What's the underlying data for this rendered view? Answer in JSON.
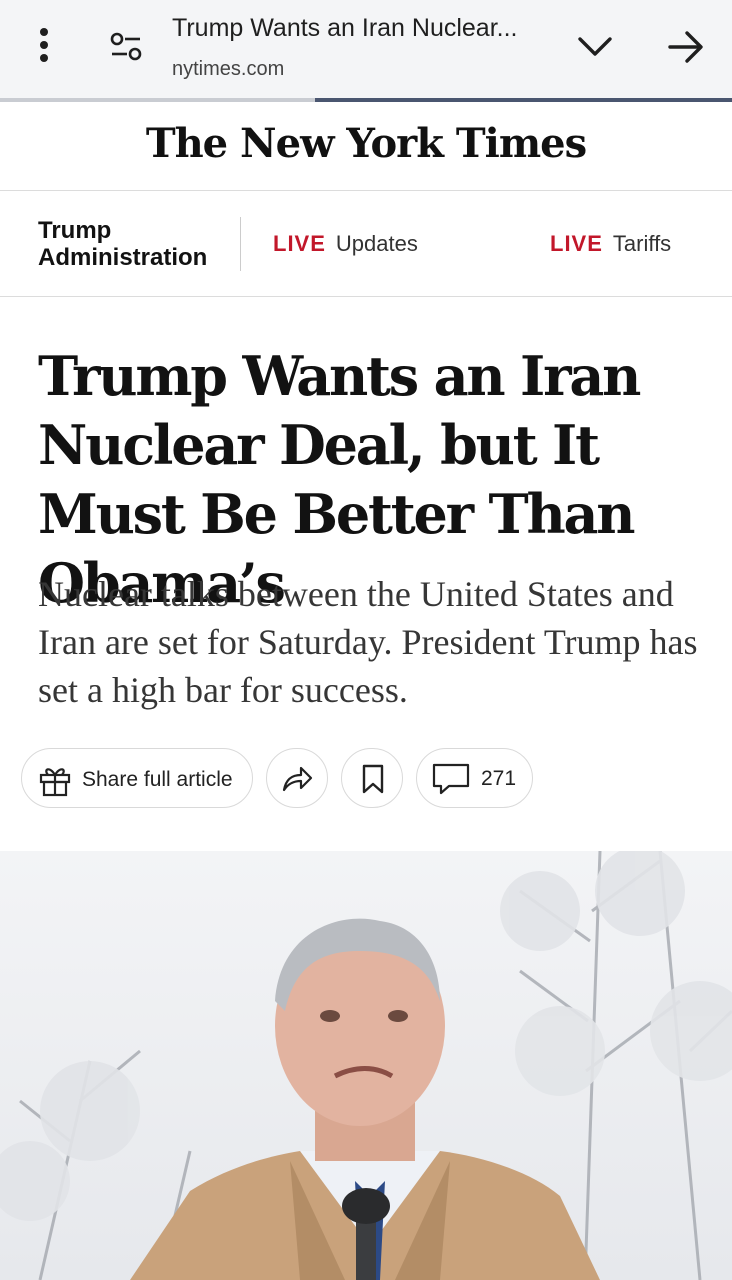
{
  "browser": {
    "page_title": "Trump Wants an Iran Nuclear...",
    "domain": "nytimes.com",
    "load_progress": 0.57
  },
  "masthead": {
    "logo_text": "The New York Times"
  },
  "nav": {
    "section": "Trump Administration",
    "links": [
      {
        "tag": "LIVE",
        "label": "Updates"
      },
      {
        "tag": "LIVE",
        "label": "Tariffs"
      }
    ]
  },
  "article": {
    "headline": "Trump Wants an Iran Nuclear Deal, but It Must Be Better Than Obama’s",
    "summary": "Nuclear talks between the United States and Iran are set for Saturday. President Trump has set a high bar for success.",
    "share_label": "Share full article",
    "comment_count": "271"
  },
  "icons": {
    "menu": "more-vert-icon",
    "tune": "tune-icon",
    "expand": "chevron-down-icon",
    "forward": "arrow-forward-icon",
    "gift": "gift-icon",
    "share": "share-arrow-icon",
    "bookmark": "bookmark-icon",
    "comment": "comment-icon"
  },
  "colors": {
    "live_red": "#c2172a",
    "progress": "#4a5670"
  }
}
